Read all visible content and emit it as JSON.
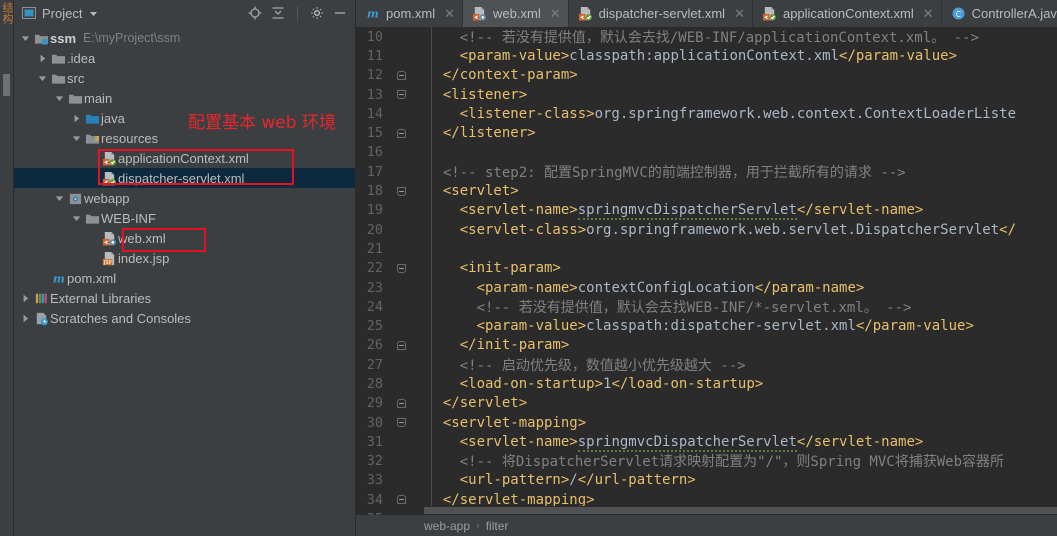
{
  "left_strip": {
    "vertical_label": "结构",
    "icon": "tool-window-strip"
  },
  "sidebar": {
    "header": {
      "title": "Project",
      "dropdown_icon": "chevron-down-icon",
      "window_icon": "project-window-icon",
      "actions": [
        {
          "name": "locate-icon",
          "label": "Select Opened File"
        },
        {
          "name": "collapse-all-icon",
          "label": "Collapse All"
        },
        {
          "name": "gear-icon",
          "label": "Settings"
        },
        {
          "name": "minimize-icon",
          "label": "Hide"
        }
      ]
    },
    "tree": [
      {
        "label": "ssm",
        "path": "E:\\myProject\\ssm",
        "icon": "module-folder-icon",
        "arrow": "expanded",
        "indent": 0,
        "bold": true,
        "selected": false
      },
      {
        "label": ".idea",
        "path": "",
        "icon": "folder-icon",
        "arrow": "collapsed",
        "indent": 1,
        "bold": false,
        "selected": false
      },
      {
        "label": "src",
        "path": "",
        "icon": "folder-icon",
        "arrow": "expanded",
        "indent": 1,
        "bold": false,
        "selected": false
      },
      {
        "label": "main",
        "path": "",
        "icon": "folder-icon",
        "arrow": "expanded",
        "indent": 2,
        "bold": false,
        "selected": false
      },
      {
        "label": "java",
        "path": "",
        "icon": "source-folder-icon",
        "arrow": "collapsed",
        "indent": 3,
        "bold": false,
        "selected": false
      },
      {
        "label": "resources",
        "path": "",
        "icon": "resource-folder-icon",
        "arrow": "expanded",
        "indent": 3,
        "bold": false,
        "selected": false
      },
      {
        "label": "applicationContext.xml",
        "path": "",
        "icon": "spring-xml-icon",
        "arrow": "none",
        "indent": 4,
        "bold": false,
        "selected": false
      },
      {
        "label": "dispatcher-servlet.xml",
        "path": "",
        "icon": "spring-xml-icon",
        "arrow": "none",
        "indent": 4,
        "bold": false,
        "selected": true
      },
      {
        "label": "webapp",
        "path": "",
        "icon": "webapp-folder-icon",
        "arrow": "expanded",
        "indent": 2,
        "bold": false,
        "selected": false
      },
      {
        "label": "WEB-INF",
        "path": "",
        "icon": "folder-icon",
        "arrow": "expanded",
        "indent": 3,
        "bold": false,
        "selected": false
      },
      {
        "label": "web.xml",
        "path": "",
        "icon": "web-xml-icon",
        "arrow": "none",
        "indent": 4,
        "bold": false,
        "selected": false
      },
      {
        "label": "index.jsp",
        "path": "",
        "icon": "jsp-file-icon",
        "arrow": "none",
        "indent": 4,
        "bold": false,
        "selected": false
      },
      {
        "label": "pom.xml",
        "path": "",
        "icon": "maven-icon",
        "arrow": "none",
        "indent": 1,
        "bold": false,
        "selected": false
      },
      {
        "label": "External Libraries",
        "path": "",
        "icon": "libraries-icon",
        "arrow": "collapsed",
        "indent": 0,
        "bold": false,
        "selected": false
      },
      {
        "label": "Scratches and Consoles",
        "path": "",
        "icon": "scratches-icon",
        "arrow": "collapsed",
        "indent": 0,
        "bold": false,
        "selected": false
      }
    ],
    "annotation": {
      "text": "配置基本 web 环境",
      "color": "#e8262c"
    },
    "highlight_color": "#e81123"
  },
  "tabs": [
    {
      "label": "pom.xml",
      "icon": "maven-icon",
      "active": false,
      "close_icon": "close-icon"
    },
    {
      "label": "web.xml",
      "icon": "web-xml-icon",
      "active": true,
      "close_icon": "close-icon"
    },
    {
      "label": "dispatcher-servlet.xml",
      "icon": "spring-xml-icon",
      "active": false,
      "close_icon": "close-icon"
    },
    {
      "label": "applicationContext.xml",
      "icon": "spring-xml-icon",
      "active": false,
      "close_icon": "close-icon"
    },
    {
      "label": "ControllerA.java",
      "icon": "java-class-icon",
      "active": false,
      "close_icon": "close-icon"
    }
  ],
  "editor": {
    "first_line_number": 10,
    "lines": [
      {
        "n": 10,
        "fold": "none",
        "indent": 4,
        "segments": [
          {
            "t": "<!-- 若没有提供值，默认会去找/WEB-INF/applicationContext.xml。  -->",
            "c": "cm"
          }
        ]
      },
      {
        "n": 11,
        "fold": "none",
        "indent": 4,
        "segments": [
          {
            "t": "<param-value>",
            "c": "tg"
          },
          {
            "t": "classpath:applicationContext.xml",
            "c": "tv"
          },
          {
            "t": "</param-value>",
            "c": "tg"
          }
        ]
      },
      {
        "n": 12,
        "fold": "end",
        "indent": 2,
        "segments": [
          {
            "t": "</context-param>",
            "c": "tg"
          }
        ]
      },
      {
        "n": 13,
        "fold": "start",
        "indent": 2,
        "segments": [
          {
            "t": "<listener>",
            "c": "tg"
          }
        ]
      },
      {
        "n": 14,
        "fold": "none",
        "indent": 4,
        "segments": [
          {
            "t": "<listener-class>",
            "c": "tg"
          },
          {
            "t": "org.springframework.web.context.ContextLoaderListe",
            "c": "tv"
          }
        ]
      },
      {
        "n": 15,
        "fold": "end",
        "indent": 2,
        "segments": [
          {
            "t": "</listener>",
            "c": "tg"
          }
        ]
      },
      {
        "n": 16,
        "fold": "none",
        "indent": 0,
        "segments": []
      },
      {
        "n": 17,
        "fold": "none",
        "indent": 2,
        "segments": [
          {
            "t": "<!-- step2: 配置SpringMVC的前端控制器，用于拦截所有的请求  -->",
            "c": "cm"
          }
        ]
      },
      {
        "n": 18,
        "fold": "start",
        "indent": 2,
        "segments": [
          {
            "t": "<servlet>",
            "c": "tg"
          }
        ]
      },
      {
        "n": 19,
        "fold": "none",
        "indent": 4,
        "segments": [
          {
            "t": "<servlet-name>",
            "c": "tg"
          },
          {
            "t": "springmvcDispatcherServlet",
            "c": "tv squig"
          },
          {
            "t": "</servlet-name>",
            "c": "tg"
          }
        ]
      },
      {
        "n": 20,
        "fold": "none",
        "indent": 4,
        "segments": [
          {
            "t": "<servlet-class>",
            "c": "tg"
          },
          {
            "t": "org.springframework.web.servlet.DispatcherServlet",
            "c": "tv"
          },
          {
            "t": "</",
            "c": "tg"
          }
        ]
      },
      {
        "n": 21,
        "fold": "none",
        "indent": 0,
        "segments": []
      },
      {
        "n": 22,
        "fold": "start",
        "indent": 4,
        "segments": [
          {
            "t": "<init-param>",
            "c": "tg"
          }
        ]
      },
      {
        "n": 23,
        "fold": "none",
        "indent": 6,
        "segments": [
          {
            "t": "<param-name>",
            "c": "tg"
          },
          {
            "t": "contextConfigLocation",
            "c": "tv"
          },
          {
            "t": "</param-name>",
            "c": "tg"
          }
        ]
      },
      {
        "n": 24,
        "fold": "none",
        "indent": 6,
        "segments": [
          {
            "t": "<!-- 若没有提供值，默认会去找WEB-INF/*-servlet.xml。  -->",
            "c": "cm"
          }
        ]
      },
      {
        "n": 25,
        "fold": "none",
        "indent": 6,
        "segments": [
          {
            "t": "<param-value>",
            "c": "tg"
          },
          {
            "t": "classpath:dispatcher-servlet.xml",
            "c": "tv"
          },
          {
            "t": "</param-value>",
            "c": "tg"
          }
        ]
      },
      {
        "n": 26,
        "fold": "end",
        "indent": 4,
        "segments": [
          {
            "t": "</init-param>",
            "c": "tg"
          }
        ]
      },
      {
        "n": 27,
        "fold": "none",
        "indent": 4,
        "segments": [
          {
            "t": "<!-- 启动优先级，数值越小优先级越大 -->",
            "c": "cm"
          }
        ]
      },
      {
        "n": 28,
        "fold": "none",
        "indent": 4,
        "segments": [
          {
            "t": "<load-on-startup>",
            "c": "tg"
          },
          {
            "t": "1",
            "c": "tv"
          },
          {
            "t": "</load-on-startup>",
            "c": "tg"
          }
        ]
      },
      {
        "n": 29,
        "fold": "end",
        "indent": 2,
        "segments": [
          {
            "t": "</servlet>",
            "c": "tg"
          }
        ]
      },
      {
        "n": 30,
        "fold": "start",
        "indent": 2,
        "segments": [
          {
            "t": "<servlet-mapping>",
            "c": "tg"
          }
        ]
      },
      {
        "n": 31,
        "fold": "none",
        "indent": 4,
        "segments": [
          {
            "t": "<servlet-name>",
            "c": "tg"
          },
          {
            "t": "springmvcDispatcherServlet",
            "c": "tv squig"
          },
          {
            "t": "</servlet-name>",
            "c": "tg"
          }
        ]
      },
      {
        "n": 32,
        "fold": "none",
        "indent": 4,
        "segments": [
          {
            "t": "<!-- 将DispatcherServlet请求映射配置为\"/\"，则Spring MVC将捕获Web容器所",
            "c": "cm"
          }
        ]
      },
      {
        "n": 33,
        "fold": "none",
        "indent": 4,
        "segments": [
          {
            "t": "<url-pattern>",
            "c": "tg"
          },
          {
            "t": "/",
            "c": "tv"
          },
          {
            "t": "</url-pattern>",
            "c": "tg"
          }
        ]
      },
      {
        "n": 34,
        "fold": "end",
        "indent": 2,
        "segments": [
          {
            "t": "</servlet-mapping>",
            "c": "tg"
          }
        ]
      },
      {
        "n": 35,
        "fold": "none",
        "indent": 0,
        "segments": []
      }
    ]
  },
  "breadcrumb": {
    "items": [
      "web-app",
      "filter"
    ],
    "separator": "›"
  }
}
